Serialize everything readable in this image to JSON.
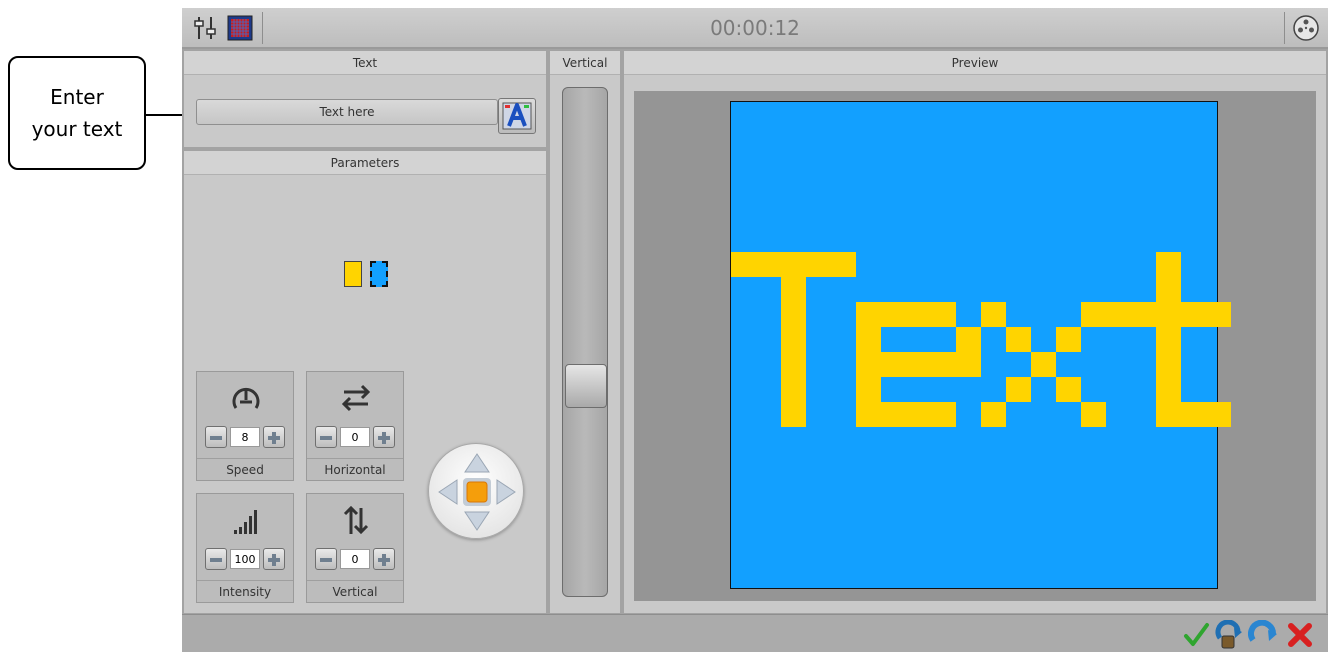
{
  "callout": {
    "line1": "Enter",
    "line2": "your text"
  },
  "toolbar": {
    "timer": "00:00:12",
    "settings_icon": "sliders-icon",
    "grid_icon": "matrix-grid-icon",
    "film_icon": "film-reel-icon"
  },
  "text_panel": {
    "title": "Text",
    "input_value": "Text here",
    "font_button_icon": "font-style-icon"
  },
  "parameters_panel": {
    "title": "Parameters",
    "colors": {
      "foreground": "#ffd400",
      "background": "#12a0ff"
    },
    "controls": {
      "speed": {
        "label": "Speed",
        "value": "8",
        "icon": "speedometer-icon"
      },
      "horizontal": {
        "label": "Horizontal",
        "value": "0",
        "icon": "horizontal-arrows-icon"
      },
      "intensity": {
        "label": "Intensity",
        "value": "100",
        "icon": "signal-bars-icon"
      },
      "vertical": {
        "label": "Vertical",
        "value": "0",
        "icon": "vertical-arrows-icon"
      }
    },
    "direction_pad_icon": "direction-pad-icon"
  },
  "vertical_panel": {
    "title": "Vertical"
  },
  "preview_panel": {
    "title": "Preview",
    "text": "Text",
    "fg": "#ffd400",
    "bg": "#12a0ff"
  },
  "bottom_actions": {
    "ok_icon": "checkmark-icon",
    "save_icon": "save-icon",
    "reset_icon": "reset-arrow-icon",
    "cancel_icon": "cancel-x-icon"
  }
}
